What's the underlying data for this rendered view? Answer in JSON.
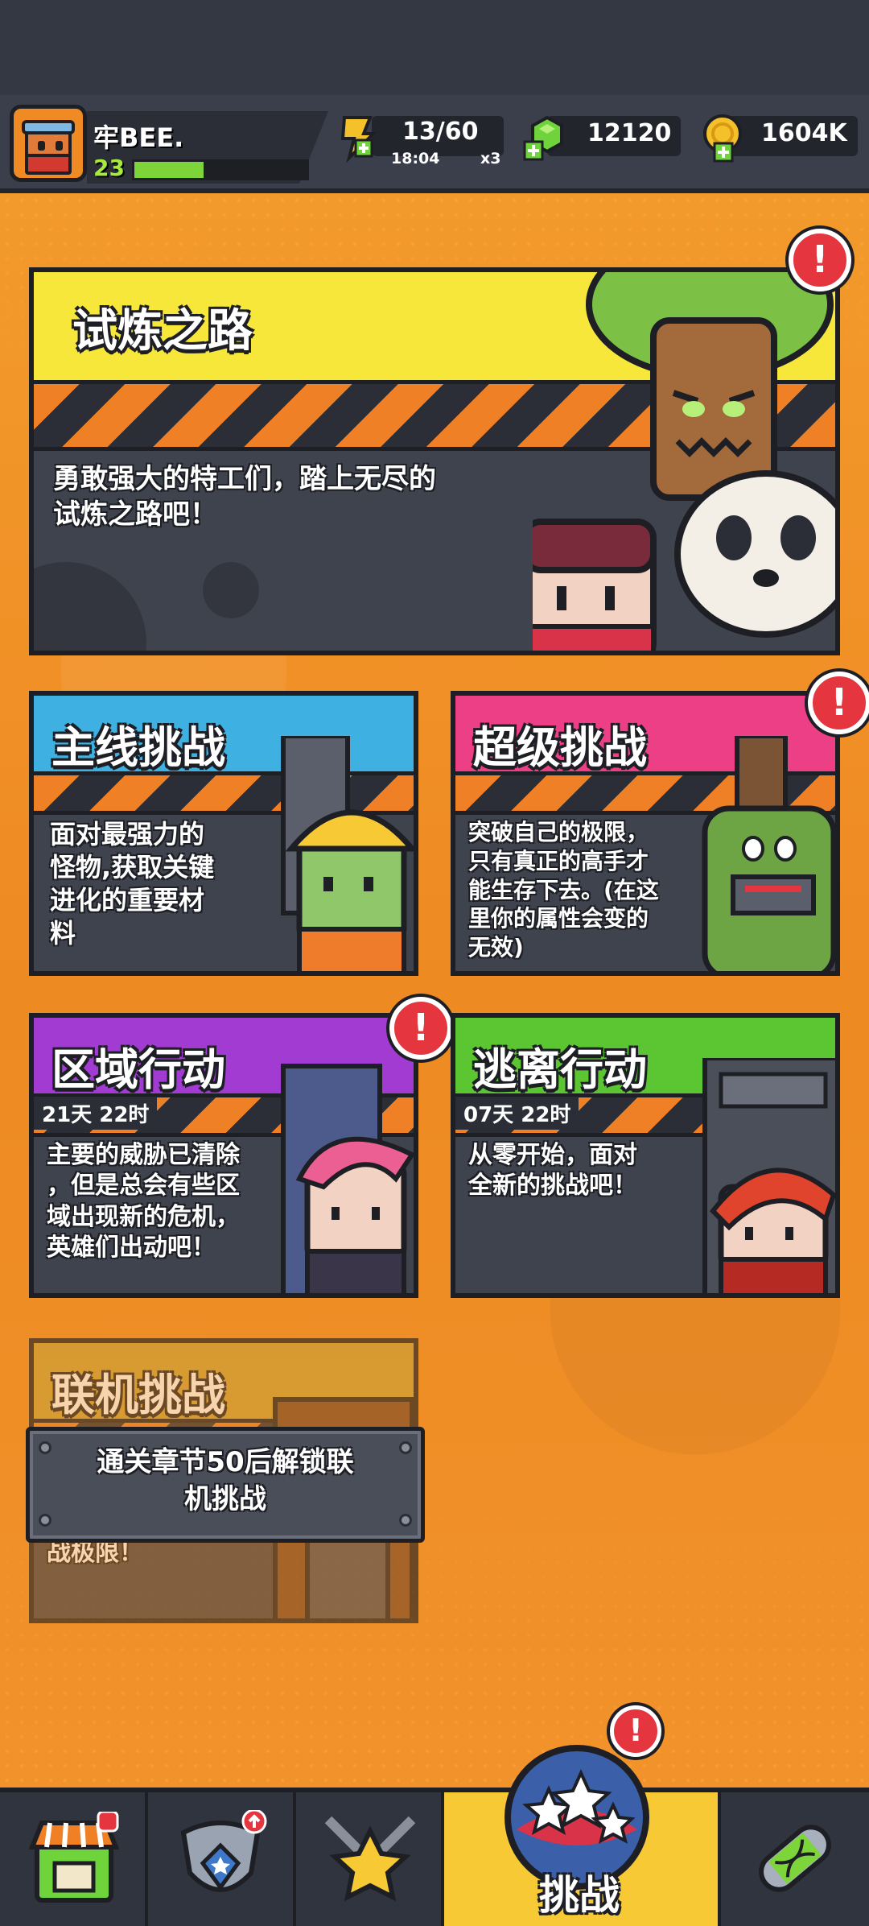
{
  "player": {
    "name": "牢BEE.",
    "level": "23",
    "xp_fraction": 0.4
  },
  "resources": {
    "energy": {
      "value": "13/60",
      "timer": "18:04",
      "multiplier": "x3"
    },
    "gems": {
      "value": "12120"
    },
    "coins": {
      "value": "1604K"
    }
  },
  "cards": {
    "trial_road": {
      "title": "试炼之路",
      "desc_line1": "勇敢强大的特工们，踏上无尽的",
      "desc_line2": "试炼之路吧！",
      "has_alert": true
    },
    "main_challenge": {
      "title": "主线挑战",
      "desc_lines": [
        "面对最强力的",
        "怪物,获取关键",
        "进化的重要材",
        "料"
      ]
    },
    "super_challenge": {
      "title": "超级挑战",
      "desc_lines": [
        "突破自己的极限，",
        "只有真正的高手才",
        "能生存下去。(在这",
        "里你的属性会变的",
        "无效)"
      ],
      "has_alert": true
    },
    "zone_action": {
      "title": "区域行动",
      "timer": "21天 22时",
      "desc_lines": [
        "主要的威胁已清除",
        "，但是总会有些区",
        "域出现新的危机，",
        "英雄们出动吧！"
      ],
      "has_alert": true
    },
    "escape_action": {
      "title": "逃离行动",
      "timer": "07天 22时",
      "desc_lines": [
        "从零开始，面对",
        "全新的挑战吧！"
      ]
    },
    "coop_challenge": {
      "title": "联机挑战",
      "desc_partial": "战极限！",
      "locked": true,
      "lock_line1": "通关章节50后解锁联",
      "lock_line2": "机挑战"
    }
  },
  "alert_symbol": "!",
  "bottom_nav": {
    "active_label": "挑战",
    "items": [
      "shop-icon",
      "shield-icon",
      "star-swords-icon",
      "challenge-planet-icon",
      "dna-capsule-icon"
    ]
  },
  "colors": {
    "background": "#f08a24",
    "trial_title": "#f6e73a",
    "main_title": "#3fb0e2",
    "super_title": "#ec3f86",
    "zone_title": "#a13bd1",
    "escape_title": "#5cc532",
    "alert": "#e5353f",
    "nav_active": "#f6c935"
  }
}
